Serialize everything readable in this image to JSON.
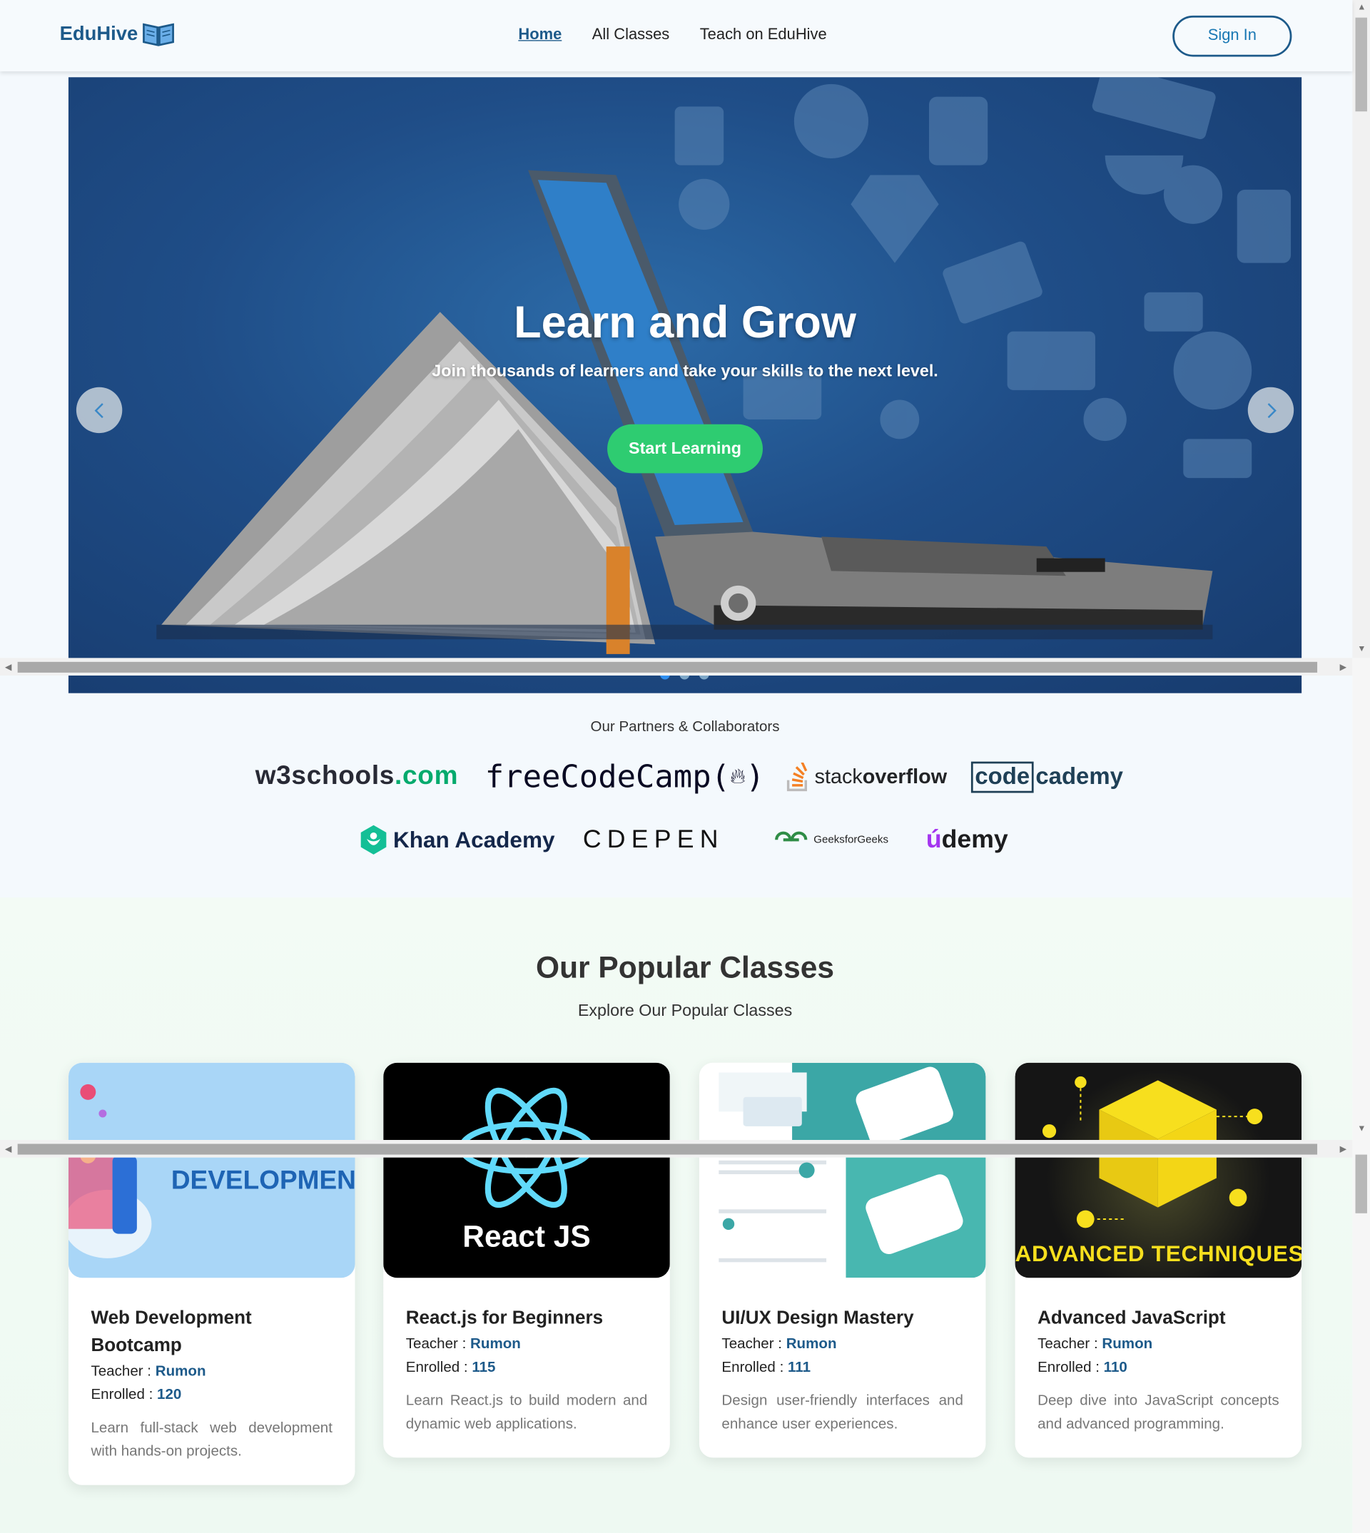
{
  "navbar": {
    "logo_text": "EduHive",
    "links": [
      {
        "label": "Home"
      },
      {
        "label": "All Classes"
      },
      {
        "label": "Teach on EduHive"
      }
    ],
    "sign_in_label": "Sign In"
  },
  "hero": {
    "title": "Learn and Grow",
    "subtitle": "Join thousands of learners and take your skills to the next level.",
    "cta_label": "Start Learning",
    "slide_count": 3,
    "active_slide": 1
  },
  "partners": {
    "title": "Our Partners & Collaborators",
    "logos": [
      {
        "main": "w3schools",
        "accent": ".com"
      },
      {
        "main": "freeCodeCamp(",
        "accent": ")"
      },
      {
        "main": "stack",
        "accent": "overflow"
      },
      {
        "main": "code",
        "accent": "cademy"
      },
      {
        "main": "Khan Academy"
      },
      {
        "main": "CDEPEN"
      },
      {
        "main": "GeeksforGeeks"
      },
      {
        "main": "demy",
        "accent": "ú"
      }
    ]
  },
  "popular": {
    "title": "Our Popular Classes",
    "subtitle": "Explore Our Popular Classes",
    "teacher_label": "Teacher : ",
    "enrolled_label": "Enrolled : ",
    "classes": [
      {
        "title": "Web Development Bootcamp",
        "teacher": "Rumon",
        "enrolled": "120",
        "description": "Learn full-stack web development with hands-on projects.",
        "image_text": "DEVELOPMEN"
      },
      {
        "title": "React.js for Beginners",
        "teacher": "Rumon",
        "enrolled": "115",
        "description": "Learn React.js to build modern and dynamic web applications.",
        "image_text": "React JS"
      },
      {
        "title": "UI/UX Design Mastery",
        "teacher": "Rumon",
        "enrolled": "111",
        "description": "Design user-friendly interfaces and enhance user experiences."
      },
      {
        "title": "Advanced JavaScript",
        "teacher": "Rumon",
        "enrolled": "110",
        "description": "Deep dive into JavaScript concepts and advanced programming.",
        "image_text": "ADVANCED TECHNIQUES"
      }
    ]
  },
  "colors": {
    "brand": "#1d5a8a",
    "cta": "#2ecc71",
    "hero_bg": "#1f4d87"
  }
}
